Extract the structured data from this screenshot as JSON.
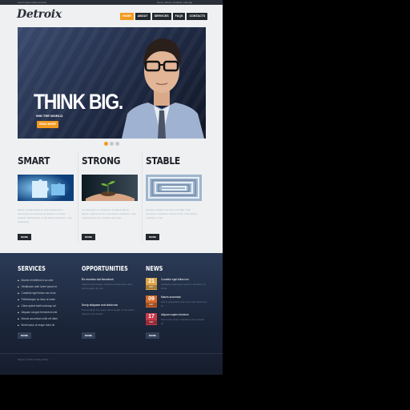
{
  "topbar": {
    "left_text": "Lorem ipsum dolor sit amet",
    "right_text": "home  |  about  |  contacts  |  sitemap"
  },
  "logo": "Detroix",
  "nav": [
    {
      "label": "Home",
      "active": true
    },
    {
      "label": "About",
      "active": false
    },
    {
      "label": "Services",
      "active": false
    },
    {
      "label": "Faqs",
      "active": false
    },
    {
      "label": "Contacts",
      "active": false
    }
  ],
  "hero": {
    "title": "THINK BIG.",
    "subtitle": "WIN THE WORLD.",
    "cta": "READ MORE"
  },
  "slider": {
    "count": 3,
    "active": 1
  },
  "columns": [
    {
      "title": "SMART",
      "text": "Mauris et pellentesque ac neque blandit tell ut ullamcorper dui hendrerit vel aliquam. In congue placerat. Mauris id arcu ut nisi dictum vestibulum. Cras scelerisque.",
      "more": "MORE"
    },
    {
      "title": "STRONG",
      "text": "Ut consectetur leo vestibulum vel aliquet dictum aliquam. Mauris id arcu ut nisi dictum vestibulum. Cras scelerisque ac ante. Vivamus nunc eget.",
      "more": "MORE"
    },
    {
      "title": "STABLE",
      "text": "Quisque at aliquet nec lorem at fringilla. Cras accumsan. Vestibulum. Mauris id arcu ut nisi dictum vestibulum. Cras.",
      "more": "MORE"
    }
  ],
  "footer": {
    "services": {
      "title": "SERVICES",
      "items": [
        "Mauris et eleifend ut ac odio",
        "Vestibulum ante lorem ipsum et",
        "Curabitur eget lectus nec et ac",
        "Pellentesque ac risus ut lorem",
        "Class aptent taciti sociosqu ad",
        "Aliquam congue fermentum nisl",
        "Mauris accumsan nulla vel diam",
        "Morbi lacus ut neque dolor sit"
      ],
      "more": "MORE"
    },
    "opportunities": {
      "title": "OPPORTUNITIES",
      "items": [
        {
          "head": "Ex montes dui tincidunt",
          "text": "Aliquam erat volutpat. Vivamus at tellus lacus. Duis iaculis sapien ac odio."
        },
        {
          "head": "Scrip aliquam sed dolorum",
          "text": "Cras ac ligula nec neque varius feugiat. Ut vel sapien. Aliquam erat volutpat."
        }
      ],
      "more": "MORE"
    },
    "news": {
      "title": "NEWS",
      "items": [
        {
          "day": "21",
          "month": "MAY",
          "color": "#e0a64a",
          "head": "Curabitur eget tellus non",
          "text": "Vestibulum ante ipsum primis in faucibus orci luctus."
        },
        {
          "day": "09",
          "month": "MAY",
          "color": "#d76a2c",
          "head": "Mauris accumsan",
          "text": "Sed ut perspiciatis unde omnis iste natus error sit."
        },
        {
          "day": "17",
          "month": "MAY",
          "color": "#c8394a",
          "head": "Aliquam sapien tincidunt",
          "text": "Nemo enim ipsam voluptatem quia voluptas sit."
        }
      ],
      "more": "MORE"
    },
    "copyright": "Detroix © 2013 | Privacy Policy"
  },
  "colors": {
    "accent": "#f39a1e",
    "dark": "#23272e",
    "footer": "#1b2539"
  }
}
